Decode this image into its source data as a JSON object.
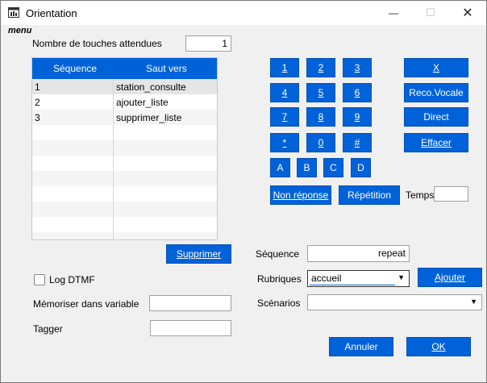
{
  "window": {
    "title": "Orientation",
    "minimize": "—",
    "maximize": "☐",
    "close": "✕"
  },
  "menu_label": "menu",
  "expected_keys": {
    "label": "Nombre de touches attendues",
    "value": "1"
  },
  "table": {
    "headers": [
      "Séquence",
      "Saut vers"
    ],
    "rows": [
      {
        "seq": "1",
        "target": "station_consulte"
      },
      {
        "seq": "2",
        "target": "ajouter_liste"
      },
      {
        "seq": "3",
        "target": "supprimer_liste"
      }
    ]
  },
  "keypad": {
    "digits": [
      "1",
      "2",
      "3",
      "4",
      "5",
      "6",
      "7",
      "8",
      "9",
      "*",
      "0",
      "#"
    ],
    "letters": [
      "A",
      "B",
      "C",
      "D"
    ],
    "side": [
      "X",
      "Reco.Vocale",
      "Direct",
      "Effacer"
    ],
    "no_answer": "Non réponse",
    "repeat": "Répétition",
    "time_label": "Temps",
    "time_value": ""
  },
  "delete_button": "Supprimer",
  "log_dtmf": {
    "label": "Log DTMF",
    "checked": false
  },
  "memorize": {
    "label": "Mémoriser dans variable",
    "value": ""
  },
  "tagger": {
    "label": "Tagger",
    "value": ""
  },
  "sequence": {
    "label": "Séquence",
    "value": "repeat"
  },
  "rubriques": {
    "label": "Rubriques",
    "value": "accueil"
  },
  "add_button": "Ajouter",
  "scenarios": {
    "label": "Scénarios",
    "value": ""
  },
  "cancel_button": "Annuler",
  "ok_button": "OK"
}
